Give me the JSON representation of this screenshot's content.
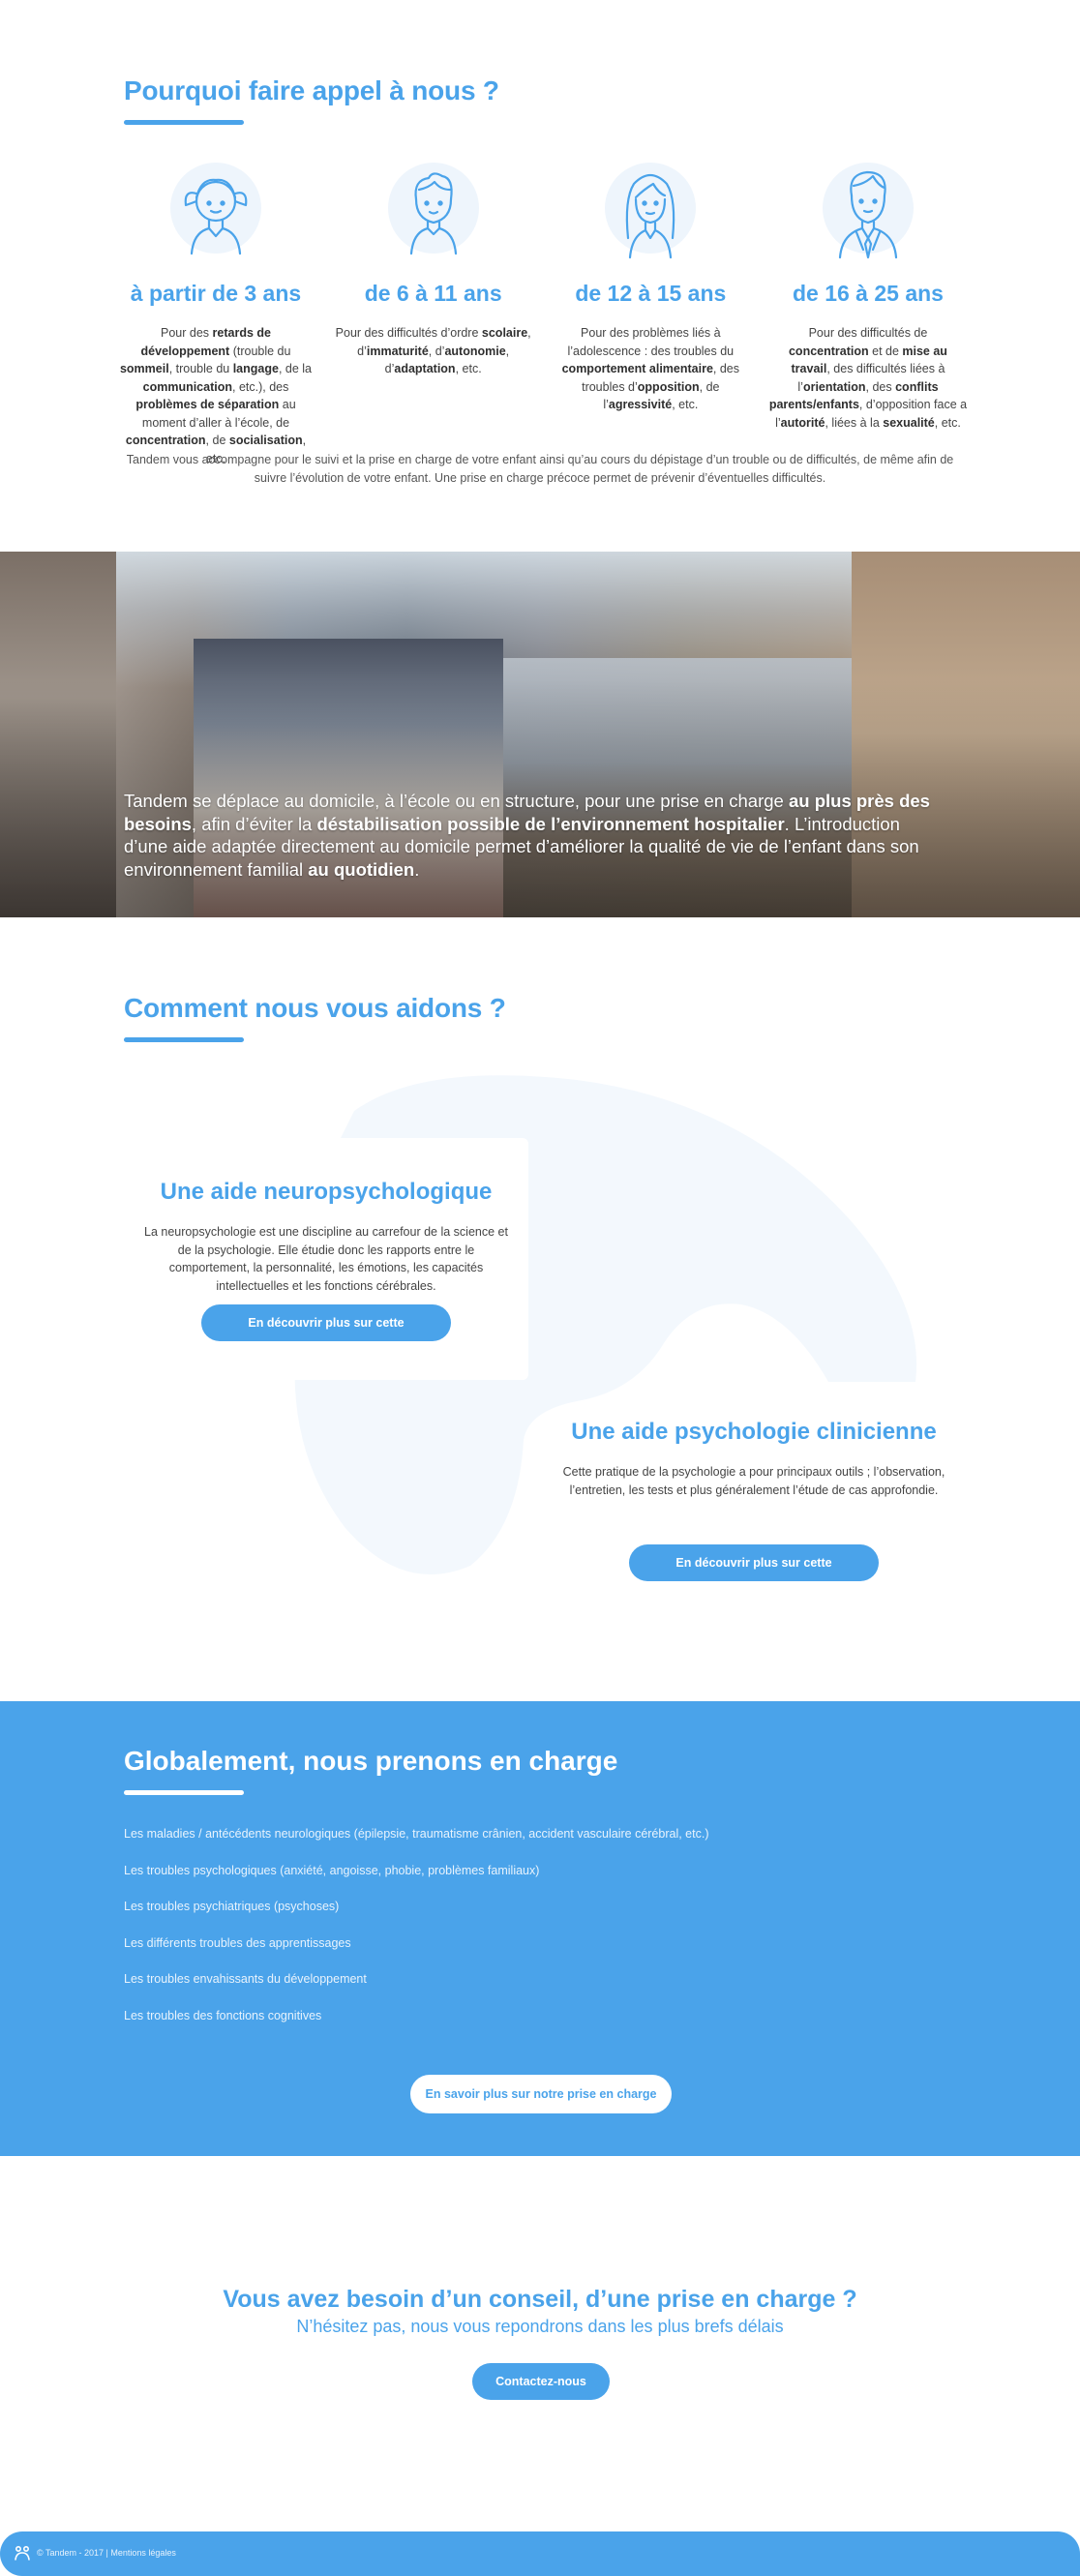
{
  "why": {
    "title": "Pourquoi faire appel à nous ?",
    "ages": [
      {
        "icon": "girl-avatar-icon",
        "heading": "à partir de 3 ans",
        "text_html": "Pour des <b>retards de développement</b> (trouble du <b>sommeil</b>, trouble du <b>langage</b>, de la <b>communication</b>, etc.), des <b>problèmes de séparation</b> au moment d’aller à l’école, de <b>concentration</b>, de <b>socialisation</b>, etc."
      },
      {
        "icon": "boy-avatar-icon",
        "heading": "de 6 à 11 ans",
        "text_html": "Pour des difficultés d’ordre <b>scolaire</b>, d’<b>immaturité</b>, d’<b>autonomie</b>, d’<b>adaptation</b>, etc."
      },
      {
        "icon": "teen-girl-avatar-icon",
        "heading": "de 12 à 15 ans",
        "text_html": "Pour des problèmes liés à l’adolescence : des troubles du <b>comportement alimentaire</b>, des troubles d’<b>opposition</b>, de l’<b>agressivité</b>, etc."
      },
      {
        "icon": "young-man-avatar-icon",
        "heading": "de 16 à 25 ans",
        "text_html": "Pour des difficultés de <b>concentration</b> et de <b>mise au travail</b>, des difficultés liées à l’<b>orientation</b>, des <b>conflits parents/enfants</b>, d’opposition face a l’<b>autorité</b>, liées à la <b>sexualité</b>, etc."
      }
    ],
    "note": "Tandem vous accompagne pour le suivi et la prise en charge de votre enfant ainsi qu’au cours du dépistage d’un trouble ou de difficultés, de même afin de suivre l’évolution de votre enfant. Une prise en charge précoce permet de prévenir d’éventuelles difficultés."
  },
  "hero": {
    "text_html": "Tandem se déplace au domicile, à l’école ou en structure, pour une prise en charge <b>au plus près des besoins</b>, afin d’éviter la <b>déstabilisation possible de l’environnement hospitalier</b>. L’introduction d’une aide adaptée directement au domicile permet d’améliorer la qualité de vie de l’enfant dans son environnement familial <b>au quotidien</b>."
  },
  "help": {
    "title": "Comment nous vous aidons ?",
    "cards": [
      {
        "title": "Une aide neuropsychologique",
        "text": "La neuropsychologie est une discipline au carrefour de la science et de la psychologie. Elle étudie donc les rapports entre le comportement, la personnalité, les émotions, les capacités intellectuelles et les fonctions cérébrales.",
        "button": "En découvrir plus sur cette spécialité"
      },
      {
        "title": "Une aide psychologie clinicienne",
        "text": "Cette pratique de la psychologie a pour principaux outils ; l’observation, l’entretien, les tests et plus généralement l’étude de cas approfondie.",
        "button": "En découvrir plus sur cette spécialité"
      }
    ]
  },
  "care": {
    "title": "Globalement, nous prenons en charge",
    "items": [
      "Les maladies / antécédents neurologiques (épilepsie, traumatisme crânien, accident vasculaire cérébral, etc.)",
      "Les troubles psychologiques (anxiété, angoisse, phobie, problèmes familiaux)",
      "Les troubles psychiatriques (psychoses)",
      "Les différents troubles des apprentissages",
      "Les troubles envahissants du développement",
      "Les troubles des fonctions cognitives"
    ],
    "button": "En savoir plus sur notre prise en charge"
  },
  "contact": {
    "title": "Vous avez besoin d’un conseil, d’une prise en charge ?",
    "subtitle": "N’hésitez pas, nous vous repondrons dans les plus brefs délais",
    "button": "Contactez-nous"
  },
  "footer": {
    "logo_icon": "tandem-logo-icon",
    "text": "© Tandem - 2017 | Mentions légales"
  },
  "colors": {
    "accent": "#4aa3ea",
    "light_blob": "#eef5fc",
    "text": "#3d3d3d"
  }
}
